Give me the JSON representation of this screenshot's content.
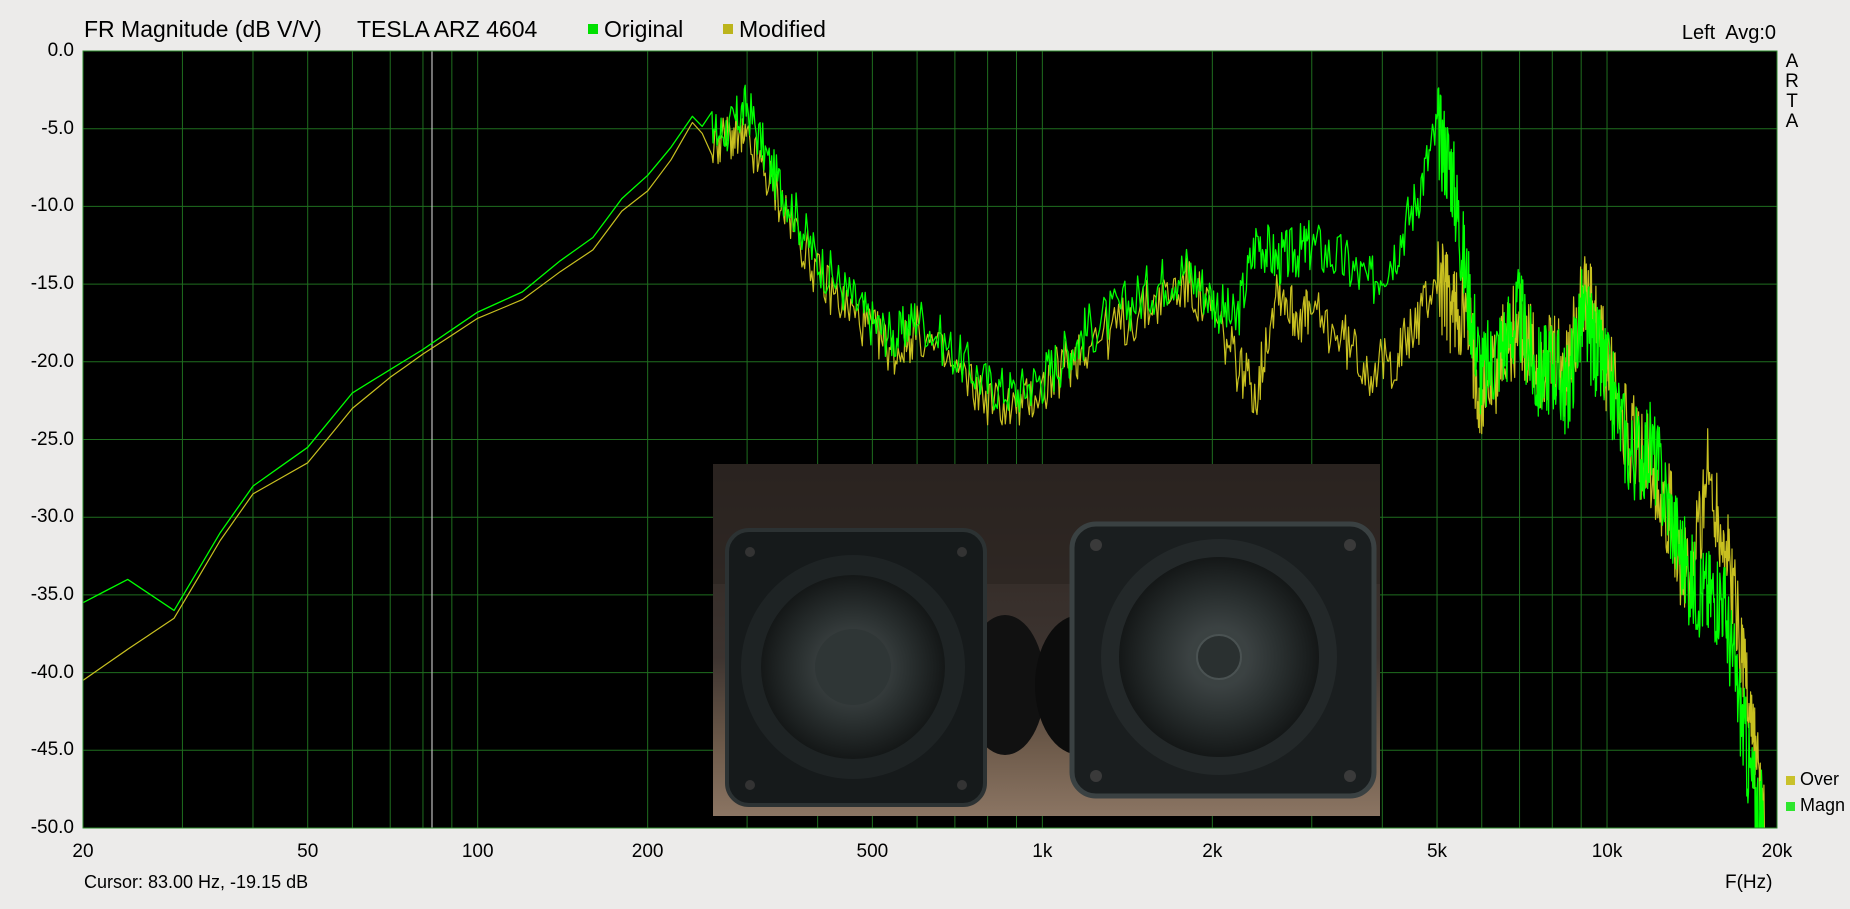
{
  "header": {
    "title": "FR Magnitude (dB V/V)",
    "subtitle": "TESLA ARZ 4604",
    "channel_info": "Left  Avg:0",
    "logo_letters": [
      "A",
      "R",
      "T",
      "A"
    ]
  },
  "footer": {
    "cursor_readout": "Cursor: 83.00 Hz, -19.15 dB",
    "x_axis_label": "F(Hz)"
  },
  "trace_legend": [
    {
      "label": "Over",
      "color": "#c9c12a"
    },
    {
      "label": "Magn",
      "color": "#2ee62e"
    }
  ],
  "colors": {
    "plot_background": "#000000",
    "grid": "#1f6e1f",
    "original": "#00ff00",
    "modified": "#c8c020"
  },
  "inset_photo": {
    "description_icon": "speaker-photo"
  },
  "chart_data": {
    "type": "line",
    "x_scale": "log",
    "xlim": [
      20,
      20000
    ],
    "ylim": [
      -50,
      0
    ],
    "grid": true,
    "cursor_hz": 83,
    "x_ticks": [
      {
        "value": 20,
        "label": "20"
      },
      {
        "value": 50,
        "label": "50"
      },
      {
        "value": 100,
        "label": "100"
      },
      {
        "value": 200,
        "label": "200"
      },
      {
        "value": 500,
        "label": "500"
      },
      {
        "value": 1000,
        "label": "1k"
      },
      {
        "value": 2000,
        "label": "2k"
      },
      {
        "value": 5000,
        "label": "5k"
      },
      {
        "value": 10000,
        "label": "10k"
      },
      {
        "value": 20000,
        "label": "20k"
      }
    ],
    "y_ticks": [
      {
        "value": 0,
        "label": "0.0"
      },
      {
        "value": -5,
        "label": "-5.0"
      },
      {
        "value": -10,
        "label": "-10.0"
      },
      {
        "value": -15,
        "label": "-15.0"
      },
      {
        "value": -20,
        "label": "-20.0"
      },
      {
        "value": -25,
        "label": "-25.0"
      },
      {
        "value": -30,
        "label": "-30.0"
      },
      {
        "value": -35,
        "label": "-35.0"
      },
      {
        "value": -40,
        "label": "-40.0"
      },
      {
        "value": -45,
        "label": "-45.0"
      },
      {
        "value": -50,
        "label": "-50.0"
      }
    ],
    "series": [
      {
        "name": "Original",
        "x": [
          20,
          24,
          29,
          35,
          40,
          50,
          60,
          70,
          80,
          100,
          120,
          140,
          160,
          180,
          200,
          220,
          240,
          260,
          280,
          300,
          330,
          360,
          400,
          450,
          500,
          550,
          600,
          700,
          800,
          900,
          1000,
          1100,
          1200,
          1400,
          1600,
          1800,
          2000,
          2200,
          2400,
          2600,
          2800,
          3000,
          3400,
          3800,
          4200,
          4600,
          5000,
          5300,
          5600,
          6000,
          6500,
          7000,
          7500,
          8000,
          8500,
          9000,
          9500,
          10000,
          11000,
          12000,
          13000,
          14000,
          15000,
          16000,
          17000,
          18000,
          19000
        ],
        "y": [
          -35.5,
          -34.0,
          -36.0,
          -31,
          -28,
          -25.5,
          -22,
          -20.5,
          -19.2,
          -16.8,
          -15.5,
          -13.5,
          -12,
          -9.5,
          -8,
          -6.2,
          -4.2,
          -5.5,
          -5,
          -3.5,
          -7.5,
          -10,
          -13.5,
          -15.5,
          -17.5,
          -18.5,
          -17,
          -19.5,
          -21.5,
          -22,
          -21,
          -19.5,
          -18,
          -16.5,
          -15,
          -14,
          -16,
          -17.5,
          -12,
          -13.5,
          -13,
          -12.5,
          -13.5,
          -15,
          -13,
          -9.5,
          -5,
          -7.5,
          -14,
          -21,
          -19,
          -17,
          -21,
          -20,
          -22,
          -17,
          -19,
          -21,
          -26,
          -25.5,
          -30,
          -34,
          -35,
          -35,
          -41,
          -47,
          -50
        ]
      },
      {
        "name": "Modified",
        "x": [
          20,
          24,
          29,
          35,
          40,
          50,
          60,
          70,
          80,
          100,
          120,
          140,
          160,
          180,
          200,
          220,
          240,
          260,
          280,
          300,
          330,
          360,
          400,
          450,
          500,
          550,
          600,
          700,
          800,
          900,
          1000,
          1100,
          1200,
          1400,
          1600,
          1800,
          2000,
          2200,
          2400,
          2600,
          2800,
          3000,
          3400,
          3800,
          4200,
          4600,
          5000,
          5300,
          5600,
          6000,
          6500,
          7000,
          7500,
          8000,
          8500,
          9000,
          9500,
          10000,
          11000,
          12000,
          13000,
          14000,
          15000,
          16000,
          17000,
          18000,
          19000
        ],
        "y": [
          -40.5,
          -38.5,
          -36.5,
          -31.5,
          -28.5,
          -26.5,
          -23,
          -21,
          -19.5,
          -17.2,
          -16,
          -14.2,
          -12.8,
          -10.3,
          -9,
          -7,
          -4.6,
          -6,
          -5.5,
          -6,
          -8.5,
          -11,
          -14.5,
          -16.5,
          -18,
          -19.5,
          -18,
          -20.5,
          -22.5,
          -23,
          -21.8,
          -20.2,
          -18.8,
          -17.5,
          -16,
          -15,
          -17,
          -20,
          -22,
          -15,
          -17,
          -17,
          -18.5,
          -20.5,
          -20,
          -17.5,
          -14.5,
          -16.5,
          -17,
          -22,
          -19.5,
          -17.5,
          -20.5,
          -20,
          -21,
          -15.5,
          -17.5,
          -20.5,
          -25,
          -26.5,
          -30,
          -35,
          -27,
          -31,
          -36,
          -43,
          -50
        ]
      }
    ]
  }
}
